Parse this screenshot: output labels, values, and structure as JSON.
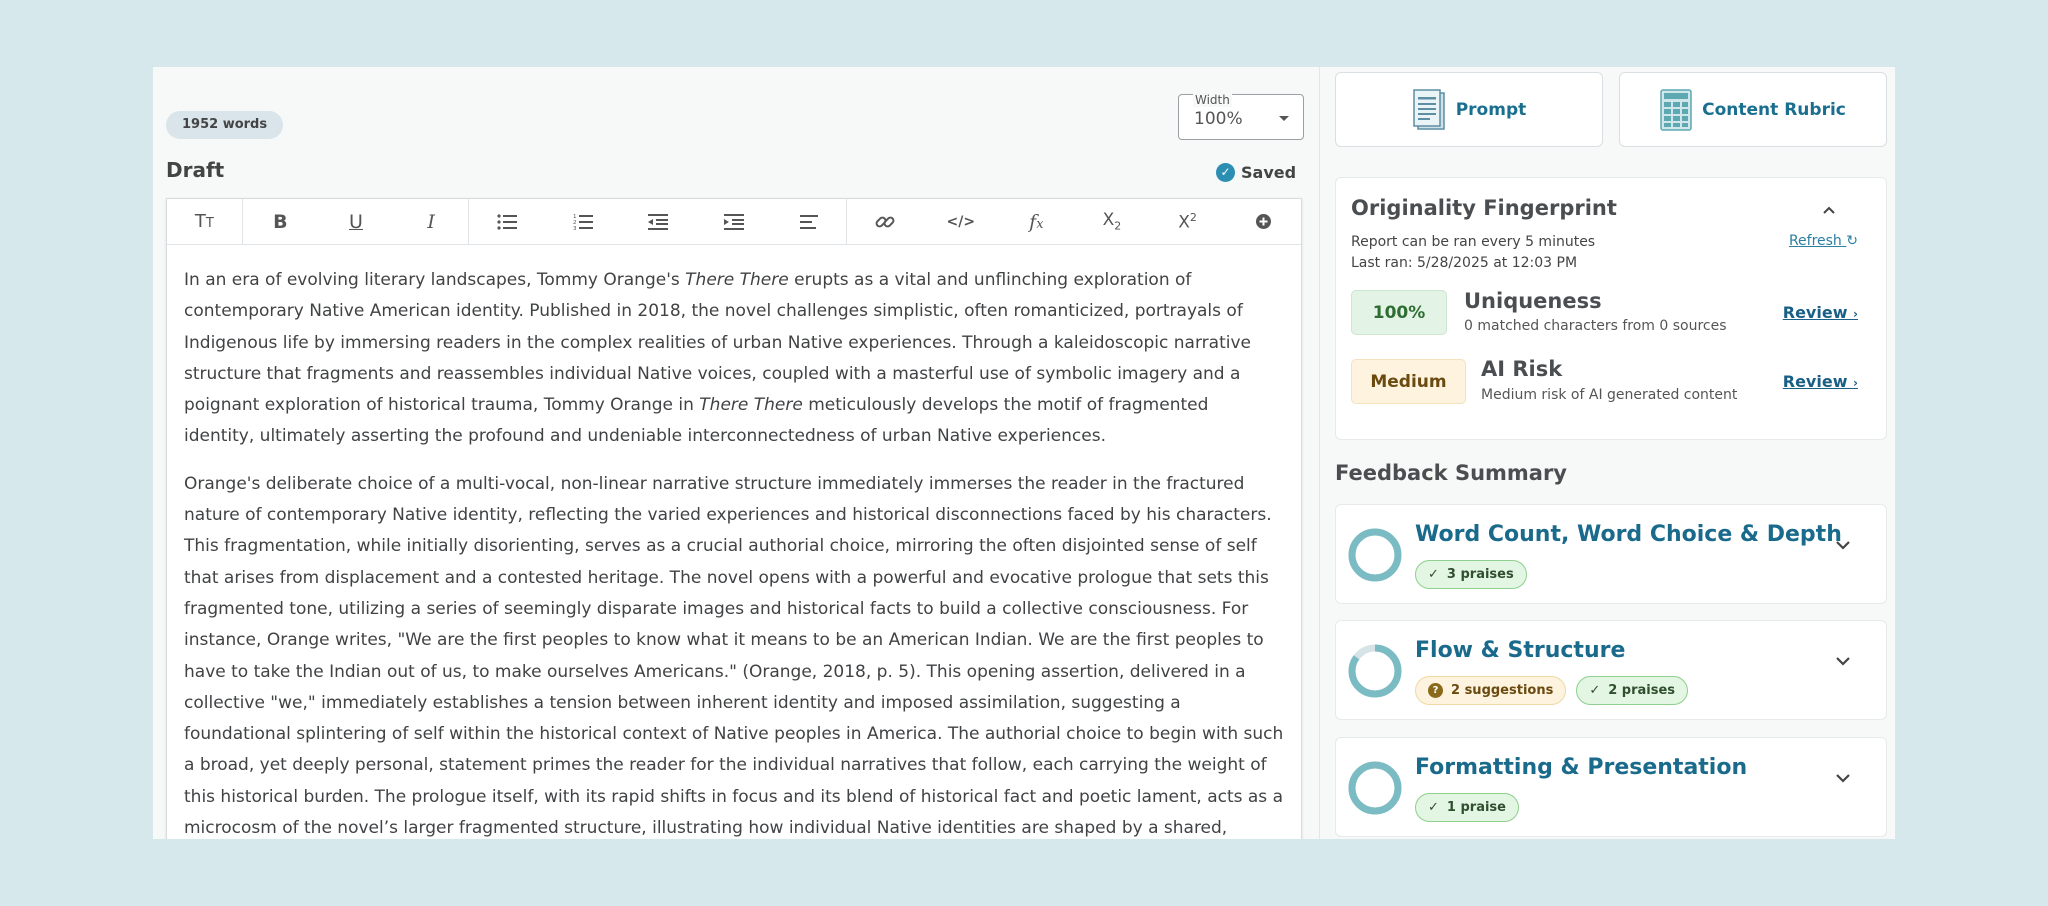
{
  "editor": {
    "word_count": "1952 words",
    "width_label": "Width",
    "width_value": "100%",
    "title": "Draft",
    "saved_label": "Saved",
    "paragraphs": [
      [
        {
          "t": "In an era of evolving literary landscapes, Tommy Orange's "
        },
        {
          "t": "There There",
          "i": true
        },
        {
          "t": " erupts as a vital and unflinching exploration of contemporary Native American identity. Published in 2018, the novel challenges simplistic, often romanticized, portrayals of Indigenous life by immersing readers in the complex realities of urban Native experiences. Through a kaleidoscopic narrative structure that fragments and reassembles individual Native voices, coupled with a masterful use of symbolic imagery and a poignant exploration of historical trauma, Tommy Orange in "
        },
        {
          "t": "There There",
          "i": true
        },
        {
          "t": " meticulously develops the motif of fragmented identity, ultimately asserting the profound and undeniable interconnectedness of urban Native experiences."
        }
      ],
      [
        {
          "t": "Orange's deliberate choice of a multi-vocal, non-linear narrative structure immediately immerses the reader in the fractured nature of contemporary Native identity, reflecting the varied experiences and historical disconnections faced by his characters. This fragmentation, while initially disorienting, serves as a crucial authorial choice, mirroring the often disjointed sense of self that arises from displacement and a contested heritage. The novel opens with a powerful and evocative prologue that sets this fragmented tone, utilizing a series of seemingly disparate images and historical facts to build a collective consciousness. For instance, Orange writes, \"We are the first peoples to know what it means to be an American Indian. We are the first peoples to have to take the Indian out of us, to make ourselves Americans.\" (Orange, 2018, p. 5). This opening assertion, delivered in a collective \"we,\" immediately establishes a tension between inherent identity and imposed assimilation, suggesting a foundational splintering of self within the historical context of Native peoples in America. The authorial choice to begin with such a broad, yet deeply personal, statement primes the reader for the individual narratives that follow, each carrying the weight of this historical burden. The prologue itself, with its rapid shifts in focus and its blend of historical fact and poetic lament, acts as a microcosm of the novel’s larger fragmented structure, illustrating how individual Native identities are shaped by a shared, though often painful, history. This early structural choice ensures that the reader understands that while the characters may appear as distinct individuals,"
        }
      ]
    ]
  },
  "toolbar": {
    "buttons": [
      "text-size",
      "bold",
      "underline",
      "italic",
      "bulleted-list",
      "numbered-list",
      "outdent",
      "indent",
      "align",
      "link",
      "code",
      "formula",
      "subscript",
      "superscript",
      "more"
    ]
  },
  "sidebar": {
    "prompt_label": "Prompt",
    "rubric_label": "Content Rubric",
    "originality": {
      "title": "Originality Fingerprint",
      "note": "Report can be ran every 5 minutes",
      "last_ran": "Last ran: 5/28/2025 at 12:03 PM",
      "refresh_label": "Refresh",
      "uniqueness": {
        "value": "100%",
        "name": "Uniqueness",
        "desc": "0 matched characters from 0 sources",
        "review": "Review"
      },
      "ai_risk": {
        "value": "Medium",
        "name": "AI Risk",
        "desc": "Medium risk of AI generated content",
        "review": "Review"
      }
    },
    "feedback": {
      "title": "Feedback Summary",
      "items": [
        {
          "title": "Word Count, Word Choice & Depth",
          "suggestions": null,
          "praises": "3 praises",
          "progress": 1.0
        },
        {
          "title": "Flow & Structure",
          "suggestions": "2 suggestions",
          "praises": "2 praises",
          "progress": 0.85
        },
        {
          "title": "Formatting & Presentation",
          "suggestions": null,
          "praises": "1 praise",
          "progress": 1.0
        }
      ]
    }
  },
  "colors": {
    "accent": "#1a6a8c",
    "ring": "#7bbbc3",
    "ring_track": "#d7e4e7",
    "praise_bg": "#e3f5e3",
    "suggestion_bg": "#fdf3de"
  }
}
